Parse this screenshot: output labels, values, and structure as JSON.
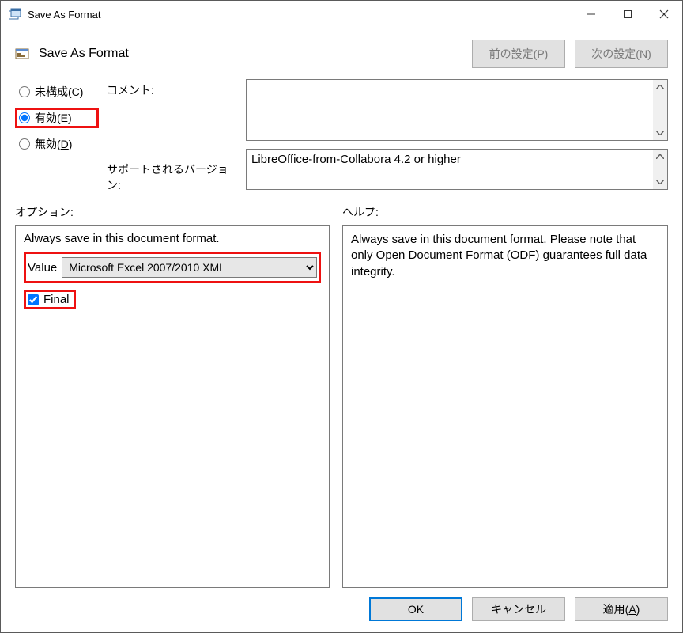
{
  "window": {
    "title": "Save As Format"
  },
  "header": {
    "title": "Save As Format",
    "prev_label": "前の設定(P)",
    "next_label": "次の設定(N)"
  },
  "status": {
    "unconfigured": "未構成(C)",
    "enabled": "有効(E)",
    "disabled": "無効(D)",
    "selected": "enabled"
  },
  "labels": {
    "comment": "コメント:",
    "supported": "サポートされるバージョン:",
    "options": "オプション:",
    "help": "ヘルプ:"
  },
  "fields": {
    "comment_value": "",
    "supported_value": "LibreOffice-from-Collabora 4.2 or higher"
  },
  "options": {
    "title": "Always save in this document format.",
    "value_label": "Value",
    "value_selected": "Microsoft Excel 2007/2010 XML",
    "final_label": "Final",
    "final_checked": true
  },
  "help": {
    "text": "Always save in this document format. Please note that only Open Document Format (ODF) guarantees full data integrity."
  },
  "buttons": {
    "ok": "OK",
    "cancel": "キャンセル",
    "apply": "適用(A)"
  }
}
